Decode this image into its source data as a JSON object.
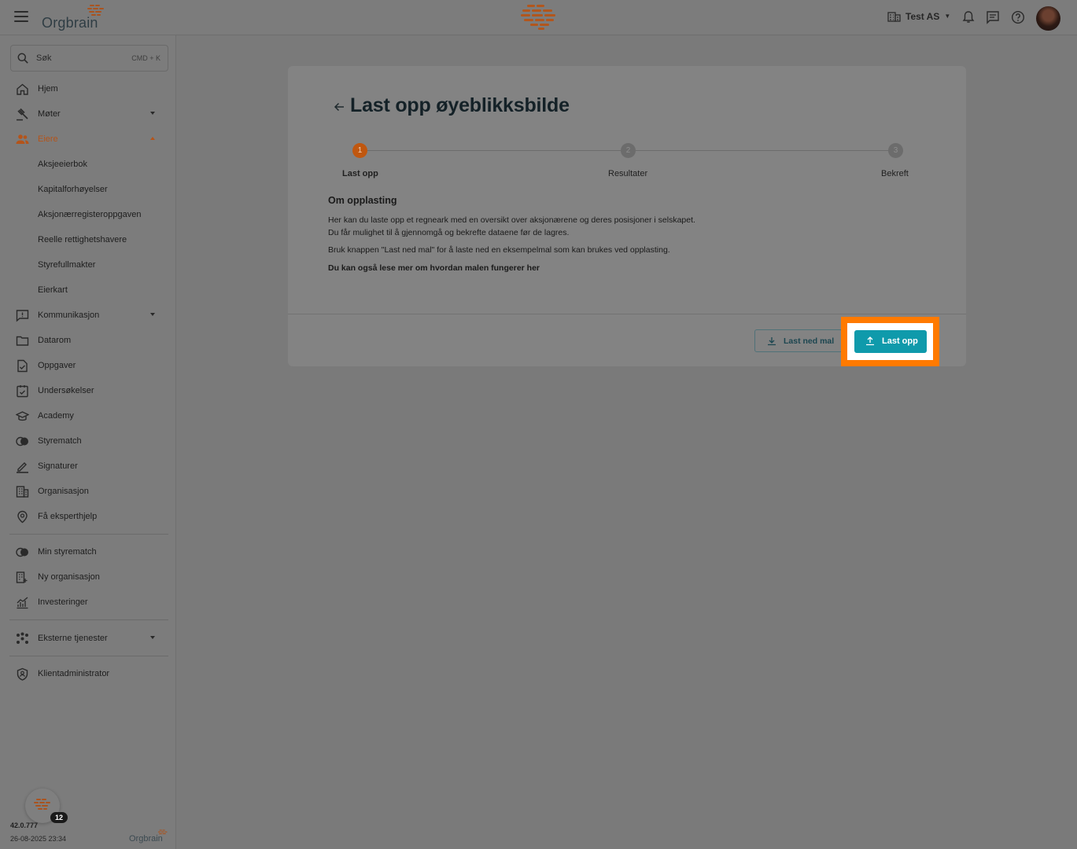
{
  "header": {
    "brand": "Orgbrain",
    "org_name": "Test AS"
  },
  "search": {
    "label": "Søk",
    "shortcut": "CMD + K"
  },
  "sidebar": {
    "items": [
      {
        "label": "Hjem",
        "icon": "home-icon"
      },
      {
        "label": "Møter",
        "icon": "gavel-icon"
      },
      {
        "label": "Eiere",
        "icon": "people-icon"
      },
      {
        "label": "Aksjeeierbok"
      },
      {
        "label": "Kapitalforhøyelser"
      },
      {
        "label": "Aksjonærregisteroppgaven"
      },
      {
        "label": "Reelle rettighetshavere"
      },
      {
        "label": "Styrefullmakter"
      },
      {
        "label": "Eierkart"
      },
      {
        "label": "Kommunikasjon",
        "icon": "announcement-icon"
      },
      {
        "label": "Datarom",
        "icon": "folder-icon"
      },
      {
        "label": "Oppgaver",
        "icon": "task-icon"
      },
      {
        "label": "Undersøkelser",
        "icon": "survey-icon"
      },
      {
        "label": "Academy",
        "icon": "school-icon"
      },
      {
        "label": "Styrematch",
        "icon": "contrast-icon"
      },
      {
        "label": "Signaturer",
        "icon": "pen-icon"
      },
      {
        "label": "Organisasjon",
        "icon": "building-icon"
      },
      {
        "label": "Få eksperthjelp",
        "icon": "help-location-icon"
      },
      {
        "label": "Min styrematch",
        "icon": "contrast-icon"
      },
      {
        "label": "Ny organisasjon",
        "icon": "building-add-icon"
      },
      {
        "label": "Investeringer",
        "icon": "chart-icon"
      },
      {
        "label": "Eksterne tjenester",
        "icon": "apps-icon"
      },
      {
        "label": "Klientadministrator",
        "icon": "shield-icon"
      }
    ],
    "version": "42.0.777",
    "timestamp": "26-08-2025 23:34",
    "footer_brand": "Orgbrain",
    "notification_count": "12"
  },
  "page": {
    "title": "Last opp øyeblikksbilde",
    "steps": [
      {
        "num": "1",
        "label": "Last opp"
      },
      {
        "num": "2",
        "label": "Resultater"
      },
      {
        "num": "3",
        "label": "Bekreft"
      }
    ],
    "section_title": "Om opplasting",
    "paragraph_1": "Her kan du laste opp et regneark med en oversikt over aksjonærene og deres posisjoner i selskapet. Du får mulighet til å gjennomgå og bekrefte dataene før de lagres.",
    "paragraph_2": "Bruk knappen \"Last ned mal\" for å laste ned en eksempelmal som kan brukes ved opplasting.",
    "paragraph_3": "Du kan også lese mer om hvordan malen fungerer her",
    "download_button": "Last ned mal",
    "upload_button": "Last opp"
  },
  "colors": {
    "accent": "#0f9aab",
    "active_step": "#c0570f",
    "highlight": "#ff7a00",
    "active_nav": "#b4541a"
  }
}
